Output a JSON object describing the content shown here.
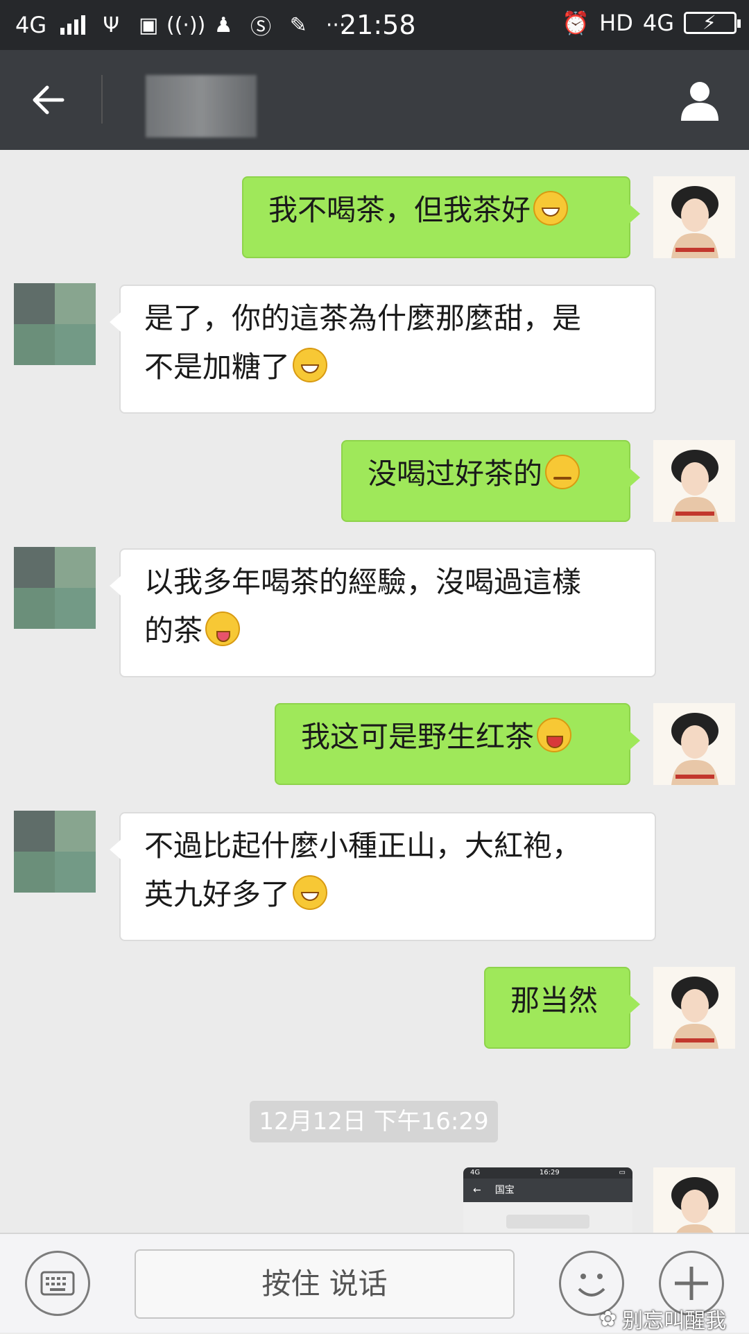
{
  "status_bar": {
    "network": "4G",
    "time": "21:58",
    "hd": "HD",
    "net_right": "4G",
    "icons": [
      "signal-icon",
      "usb-icon",
      "usb-debug-icon",
      "hotspot-icon",
      "qq-icon",
      "s-app-icon",
      "brush-icon",
      "more-dots-icon",
      "alarm-icon",
      "battery-charging-icon"
    ]
  },
  "header": {
    "back_icon": "arrow-left-icon",
    "profile_icon": "person-icon"
  },
  "messages": [
    {
      "side": "me",
      "text": "我不喝茶，但我茶好",
      "emoji": "grin"
    },
    {
      "side": "other",
      "line1": "是了，你的這茶為什麼那麼甜，是",
      "line2": "不是加糖了",
      "emoji": "grin"
    },
    {
      "side": "me",
      "text": "没喝过好茶的",
      "emoji": "confused"
    },
    {
      "side": "other",
      "line1": "以我多年喝茶的經驗，沒喝過這樣",
      "line2": "的茶",
      "emoji": "wink-tongue"
    },
    {
      "side": "me",
      "text": "我这可是野生红茶",
      "emoji": "tongue"
    },
    {
      "side": "other",
      "line1": "不過比起什麼小種正山，大紅袍，",
      "line2": "英九好多了",
      "emoji": "grin"
    },
    {
      "side": "me",
      "text": "那当然"
    }
  ],
  "timestamp": "12月12日 下午16:29",
  "screenshot_thumb": {
    "title": "国宝",
    "time": "16:29"
  },
  "input_bar": {
    "talk_label": "按住 说话",
    "keyboard_icon": "keyboard-icon",
    "emoji_icon": "smiley-icon",
    "plus_icon": "plus-icon"
  },
  "watermark": "别忘叫醒我",
  "colors": {
    "my_bubble": "#9fe85a",
    "other_bubble": "#ffffff",
    "header": "#3a3d41",
    "background": "#ebebeb"
  }
}
